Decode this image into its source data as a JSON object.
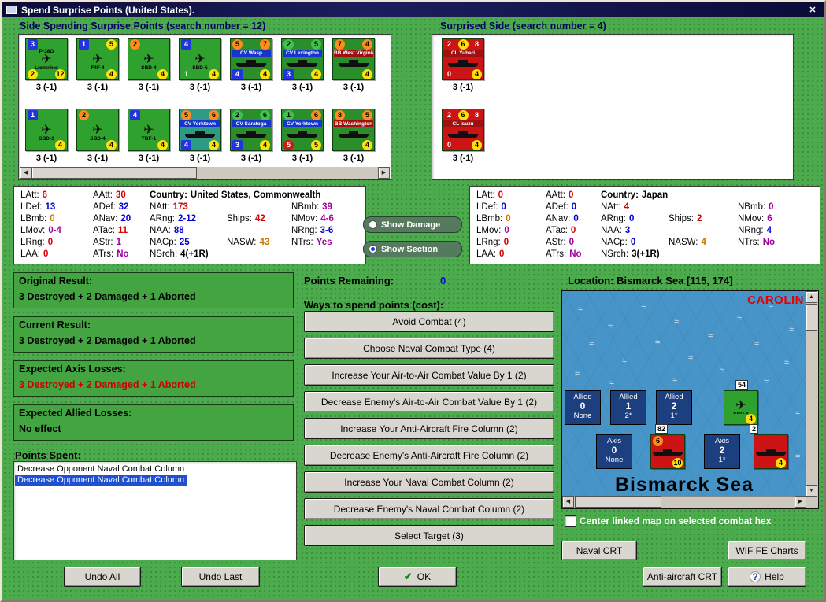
{
  "window": {
    "title": "Spend Surprise Points (United States)."
  },
  "icons": {
    "close": "✕",
    "check": "✔",
    "help": "?",
    "plane": "✈",
    "wave": "≈",
    "up": "▲",
    "down": "▼",
    "left": "◀",
    "right": "▶"
  },
  "headings": {
    "left_panel": "Side Spending Surprise Points (search number = 12)",
    "right_panel": "Surprised Side (search number = 4)",
    "location": "Location: Bismarck Sea [115, 174]",
    "points_remaining_label": "Points Remaining:",
    "points_remaining_value": "0",
    "ways_label": "Ways to spend points (cost):",
    "points_spent_label": "Points Spent:"
  },
  "us_units": [
    {
      "name": "P-38G",
      "name2": "Lightning",
      "kind": "air",
      "body": "#2fa12f",
      "top": [
        {
          "t": "3",
          "c": "b"
        }
      ],
      "bot": [
        {
          "t": "2",
          "c": "y"
        },
        {
          "t": "12",
          "c": "y"
        }
      ],
      "caption": "3 (-1)"
    },
    {
      "name": "F4F-4",
      "kind": "air",
      "body": "#2fa12f",
      "top": [
        {
          "t": "1",
          "c": "b"
        },
        {
          "t": "5",
          "c": "y"
        }
      ],
      "bot": [
        {
          "t": "4",
          "c": "y"
        }
      ],
      "caption": "3 (-1)"
    },
    {
      "name": "SBD-4",
      "kind": "air",
      "body": "#2fa12f",
      "top": [
        {
          "t": "2",
          "c": "o"
        }
      ],
      "bot": [
        {
          "t": "4",
          "c": "y"
        }
      ],
      "caption": "3 (-1)"
    },
    {
      "name": "SBD-5",
      "kind": "air",
      "body": "#2fa12f",
      "top": [
        {
          "t": "4",
          "c": "b"
        }
      ],
      "bot": [
        {
          "t": "1",
          "c": "w"
        },
        {
          "t": "4",
          "c": "y"
        }
      ],
      "caption": "3 (-1)"
    },
    {
      "name": "CV Wasp",
      "kind": "ship",
      "body": "#2a8f2a",
      "bar": "#1535cc",
      "top": [
        {
          "t": "5",
          "c": "o"
        },
        {
          "t": "7",
          "c": "o"
        }
      ],
      "bot": [
        {
          "t": "4",
          "c": "b"
        },
        {
          "t": "4",
          "c": "y"
        }
      ],
      "caption": "3 (-1)"
    },
    {
      "name": "CV Lexington",
      "kind": "ship",
      "body": "#2a8f2a",
      "bar": "#1535cc",
      "top": [
        {
          "t": "2",
          "c": "g"
        },
        {
          "t": "5",
          "c": "g"
        }
      ],
      "bot": [
        {
          "t": "3",
          "c": "b"
        },
        {
          "t": "4",
          "c": "y"
        }
      ],
      "caption": "3 (-1)"
    },
    {
      "name": "BB West Virginia",
      "kind": "ship",
      "body": "#2a8f2a",
      "bar": "#a01010",
      "top": [
        {
          "t": "7",
          "c": "o"
        },
        {
          "t": "4",
          "c": "o"
        }
      ],
      "bot": [
        {
          "t": "4",
          "c": "y"
        }
      ],
      "caption": "3 (-1)"
    },
    {
      "name": "SBD-3",
      "kind": "air",
      "body": "#2fa12f",
      "top": [
        {
          "t": "1",
          "c": "b"
        }
      ],
      "bot": [
        {
          "t": "4",
          "c": "y"
        }
      ],
      "caption": "3 (-1)"
    },
    {
      "name": "SBD-4",
      "kind": "air",
      "body": "#2fa12f",
      "top": [
        {
          "t": "2",
          "c": "o"
        }
      ],
      "bot": [
        {
          "t": "4",
          "c": "y"
        }
      ],
      "caption": "3 (-1)"
    },
    {
      "name": "TBF-1",
      "kind": "air",
      "body": "#2fa12f",
      "top": [
        {
          "t": "4",
          "c": "b"
        }
      ],
      "bot": [
        {
          "t": "4",
          "c": "y"
        }
      ],
      "caption": "3 (-1)"
    },
    {
      "name": "CV Yorktown",
      "kind": "ship",
      "body": "#2e9b85",
      "bar": "#1535cc",
      "top": [
        {
          "t": "5",
          "c": "o"
        },
        {
          "t": "6",
          "c": "o"
        }
      ],
      "bot": [
        {
          "t": "4",
          "c": "b"
        },
        {
          "t": "4",
          "c": "y"
        }
      ],
      "caption": "3 (-1)"
    },
    {
      "name": "CV Saratoga",
      "kind": "ship",
      "body": "#2a8f2a",
      "bar": "#1535cc",
      "top": [
        {
          "t": "2",
          "c": "g"
        },
        {
          "t": "6",
          "c": "g"
        }
      ],
      "bot": [
        {
          "t": "3",
          "c": "b"
        },
        {
          "t": "4",
          "c": "y"
        }
      ],
      "caption": "3 (-1)"
    },
    {
      "name": "CV Yorktown",
      "kind": "ship",
      "body": "#2a8f2a",
      "bar": "#1535cc",
      "top": [
        {
          "t": "1",
          "c": "g"
        },
        {
          "t": "6",
          "c": "o"
        }
      ],
      "bot": [
        {
          "t": "5",
          "c": "r"
        },
        {
          "t": "5",
          "c": "y"
        }
      ],
      "caption": "3 (-1)"
    },
    {
      "name": "BB Washington",
      "kind": "ship",
      "body": "#2a8f2a",
      "bar": "#a01010",
      "top": [
        {
          "t": "8",
          "c": "o"
        },
        {
          "t": "5",
          "c": "o"
        }
      ],
      "bot": [
        {
          "t": "4",
          "c": "y"
        }
      ],
      "caption": "3 (-1)"
    }
  ],
  "jp_units": [
    {
      "name": "CL Yubari",
      "kind": "ship",
      "body": "#cc1414",
      "bar": "#a01010",
      "top": [
        {
          "t": "2",
          "c": "w"
        },
        {
          "t": "6",
          "c": "y"
        },
        {
          "t": "8",
          "c": "w"
        }
      ],
      "bot": [
        {
          "t": "0",
          "c": "w"
        },
        {
          "t": "4",
          "c": "y"
        }
      ],
      "caption": "3 (-1)"
    },
    {
      "name": "CL Isuzu",
      "kind": "ship",
      "body": "#cc1414",
      "bar": "#a01010",
      "top": [
        {
          "t": "2",
          "c": "w"
        },
        {
          "t": "6",
          "c": "y"
        },
        {
          "t": "8",
          "c": "w"
        }
      ],
      "bot": [
        {
          "t": "0",
          "c": "w"
        },
        {
          "t": "4",
          "c": "y"
        }
      ],
      "caption": "3 (-1)"
    }
  ],
  "stats_left": {
    "cells": [
      {
        "r": 0,
        "c": 0,
        "l": "LAtt:",
        "v": "6",
        "k": "r"
      },
      {
        "r": 0,
        "c": 1,
        "l": "AAtt:",
        "v": "30",
        "k": "r"
      },
      {
        "r": 0,
        "c": 2,
        "l": "Country:",
        "v": "United States, Commonwealth",
        "k": "k",
        "bold": true
      },
      {
        "r": 1,
        "c": 0,
        "l": "LDef:",
        "v": "13",
        "k": "b"
      },
      {
        "r": 1,
        "c": 1,
        "l": "ADef:",
        "v": "32",
        "k": "b"
      },
      {
        "r": 1,
        "c": 2,
        "l": "NAtt:",
        "v": "173",
        "k": "r"
      },
      {
        "r": 1,
        "c": 4,
        "l": "NBmb:",
        "v": "39",
        "k": "p"
      },
      {
        "r": 2,
        "c": 0,
        "l": "LBmb:",
        "v": "0",
        "k": "o"
      },
      {
        "r": 2,
        "c": 1,
        "l": "ANav:",
        "v": "20",
        "k": "b"
      },
      {
        "r": 2,
        "c": 2,
        "l": "ARng:",
        "v": "2-12",
        "k": "b"
      },
      {
        "r": 2,
        "c": 3,
        "l": "Ships:",
        "v": "42",
        "k": "r"
      },
      {
        "r": 2,
        "c": 4,
        "l": "NMov:",
        "v": "4-6",
        "k": "p"
      },
      {
        "r": 3,
        "c": 0,
        "l": "LMov:",
        "v": "0-4",
        "k": "p"
      },
      {
        "r": 3,
        "c": 1,
        "l": "ATac:",
        "v": "11",
        "k": "r"
      },
      {
        "r": 3,
        "c": 2,
        "l": "NAA:",
        "v": "88",
        "k": "b"
      },
      {
        "r": 3,
        "c": 4,
        "l": "NRng:",
        "v": "3-6",
        "k": "b"
      },
      {
        "r": 4,
        "c": 0,
        "l": "LRng:",
        "v": "0",
        "k": "r"
      },
      {
        "r": 4,
        "c": 1,
        "l": "AStr:",
        "v": "1",
        "k": "p"
      },
      {
        "r": 4,
        "c": 2,
        "l": "NACp:",
        "v": "25",
        "k": "b"
      },
      {
        "r": 4,
        "c": 3,
        "l": "NASW:",
        "v": "43",
        "k": "o"
      },
      {
        "r": 4,
        "c": 4,
        "l": "NTrs:",
        "v": "Yes",
        "k": "p"
      },
      {
        "r": 5,
        "c": 0,
        "l": "LAA:",
        "v": "0",
        "k": "r"
      },
      {
        "r": 5,
        "c": 1,
        "l": "ATrs:",
        "v": "No",
        "k": "p"
      },
      {
        "r": 5,
        "c": 2,
        "l": "NSrch:",
        "v": "4(+1R)",
        "k": "k"
      }
    ]
  },
  "stats_right": {
    "cells": [
      {
        "r": 0,
        "c": 0,
        "l": "LAtt:",
        "v": "0",
        "k": "r"
      },
      {
        "r": 0,
        "c": 1,
        "l": "AAtt:",
        "v": "0",
        "k": "r"
      },
      {
        "r": 0,
        "c": 2,
        "l": "Country:",
        "v": "Japan",
        "k": "k",
        "bold": true
      },
      {
        "r": 1,
        "c": 0,
        "l": "LDef:",
        "v": "0",
        "k": "b"
      },
      {
        "r": 1,
        "c": 1,
        "l": "ADef:",
        "v": "0",
        "k": "b"
      },
      {
        "r": 1,
        "c": 2,
        "l": "NAtt:",
        "v": "4",
        "k": "r"
      },
      {
        "r": 1,
        "c": 4,
        "l": "NBmb:",
        "v": "0",
        "k": "p"
      },
      {
        "r": 2,
        "c": 0,
        "l": "LBmb:",
        "v": "0",
        "k": "o"
      },
      {
        "r": 2,
        "c": 1,
        "l": "ANav:",
        "v": "0",
        "k": "b"
      },
      {
        "r": 2,
        "c": 2,
        "l": "ARng:",
        "v": "0",
        "k": "b"
      },
      {
        "r": 2,
        "c": 3,
        "l": "Ships:",
        "v": "2",
        "k": "r"
      },
      {
        "r": 2,
        "c": 4,
        "l": "NMov:",
        "v": "6",
        "k": "p"
      },
      {
        "r": 3,
        "c": 0,
        "l": "LMov:",
        "v": "0",
        "k": "p"
      },
      {
        "r": 3,
        "c": 1,
        "l": "ATac:",
        "v": "0",
        "k": "r"
      },
      {
        "r": 3,
        "c": 2,
        "l": "NAA:",
        "v": "3",
        "k": "b"
      },
      {
        "r": 3,
        "c": 4,
        "l": "NRng:",
        "v": "4",
        "k": "b"
      },
      {
        "r": 4,
        "c": 0,
        "l": "LRng:",
        "v": "0",
        "k": "r"
      },
      {
        "r": 4,
        "c": 1,
        "l": "AStr:",
        "v": "0",
        "k": "p"
      },
      {
        "r": 4,
        "c": 2,
        "l": "NACp:",
        "v": "0",
        "k": "b"
      },
      {
        "r": 4,
        "c": 3,
        "l": "NASW:",
        "v": "4",
        "k": "o"
      },
      {
        "r": 4,
        "c": 4,
        "l": "NTrs:",
        "v": "No",
        "k": "p"
      },
      {
        "r": 5,
        "c": 0,
        "l": "LAA:",
        "v": "0",
        "k": "r"
      },
      {
        "r": 5,
        "c": 1,
        "l": "ATrs:",
        "v": "No",
        "k": "p"
      },
      {
        "r": 5,
        "c": 2,
        "l": "NSrch:",
        "v": "3(+1R)",
        "k": "k"
      }
    ]
  },
  "radios": [
    {
      "label": "Show Damage",
      "selected": false
    },
    {
      "label": "Show Section",
      "selected": true
    }
  ],
  "results": [
    {
      "title": "Original Result:",
      "text": "3 Destroyed + 2 Damaged + 1 Aborted",
      "color": "#000000"
    },
    {
      "title": "Current Result:",
      "text": "3 Destroyed + 2 Damaged + 1 Aborted",
      "color": "#000000"
    },
    {
      "title": "Expected Axis Losses:",
      "text": "3 Destroyed + 2 Damaged + 1 Aborted",
      "color": "#cc0000"
    },
    {
      "title": "Expected Allied Losses:",
      "text": "No effect",
      "color": "#000000"
    }
  ],
  "points_spent_items": [
    {
      "text": "Decrease Opponent Naval Combat Column",
      "selected": false
    },
    {
      "text": "Decrease Opponent Naval Combat Column",
      "selected": true
    }
  ],
  "spend_buttons": [
    "Avoid Combat (4)",
    "Choose Naval Combat Type (4)",
    "Increase Your Air-to-Air Combat Value By 1 (2)",
    "Decrease Enemy's Air-to-Air Combat Value By 1 (2)",
    "Increase Your Anti-Aircraft Fire Column (2)",
    "Decrease Enemy's Anti-Aircraft Fire Column (2)",
    "Increase Your Naval Combat Column (2)",
    "Decrease Enemy's Naval Combat Column (2)",
    "Select Target (3)"
  ],
  "map": {
    "region_label": "CAROLIN",
    "sea_label": "Bismarck Sea",
    "stack_labels": [
      "54",
      "82",
      "2"
    ],
    "hex_boxes": [
      {
        "side": "Allied",
        "num": "0",
        "sub": "None"
      },
      {
        "side": "Allied",
        "num": "1",
        "sub": "2*"
      },
      {
        "side": "Allied",
        "num": "2",
        "sub": "1*"
      },
      {
        "side": "Axis",
        "num": "0",
        "sub": "None"
      },
      {
        "side": "Axis",
        "num": "2",
        "sub": "1*"
      }
    ],
    "counters": [
      {
        "name": "SBD-4",
        "kind": "air",
        "body": "#2fa12f",
        "top": [],
        "bot": [
          {
            "t": "4",
            "c": "y"
          }
        ]
      },
      {
        "name": "",
        "kind": "ship",
        "body": "#cc1414",
        "top": [
          {
            "t": "6",
            "c": "o"
          }
        ],
        "bot": [
          {
            "t": "10",
            "c": "y"
          }
        ]
      },
      {
        "name": "",
        "kind": "ship",
        "body": "#cc1414",
        "top": [],
        "bot": [
          {
            "t": "4",
            "c": "y"
          }
        ]
      }
    ]
  },
  "checkbox": {
    "label": "Center linked map on selected combat hex",
    "checked": false
  },
  "buttons": {
    "naval_crt": "Naval CRT",
    "wif_charts": "WIF FE Charts",
    "undo_all": "Undo All",
    "undo_last": "Undo Last",
    "ok": "OK",
    "aa_crt": "Anti-aircraft CRT",
    "help": "Help"
  }
}
